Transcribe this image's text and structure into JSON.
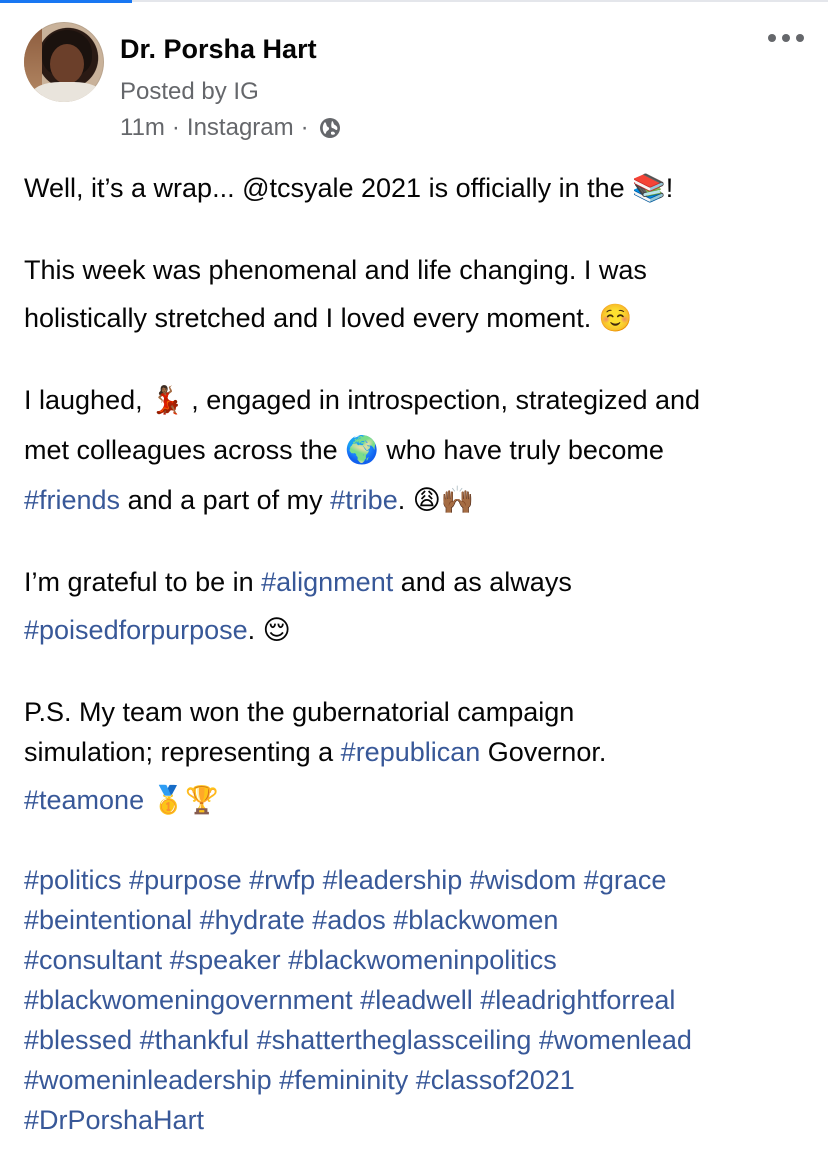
{
  "post": {
    "author": "Dr. Porsha Hart",
    "posted_by": "Posted by IG",
    "time": "11m",
    "source": "Instagram",
    "separator": "·",
    "icons": {
      "privacy": "globe-icon",
      "menu": "more-options-icon"
    }
  },
  "body": {
    "p1": {
      "l1": "Well, it’s  a wrap... @tcsyale 2021 is officially in the 📚!"
    },
    "p2": {
      "l1": "This week was phenomenal and life changing. I was",
      "l2": "holistically stretched  and I loved every moment. ☺️"
    },
    "p3": {
      "l1": "I laughed, 💃🏾 , engaged in introspection, strategized and",
      "l2": "met colleagues across the 🌍 who have truly become",
      "l3_tag1": "#friends",
      "l3_text1": " and a part of my ",
      "l3_tag2": "#tribe",
      "l3_text2": ".  😩🙌🏾"
    },
    "p4": {
      "l1_text1": "I’m grateful to be in ",
      "l1_tag1": "#alignment",
      "l1_text2": " and as always",
      "l2_tag1": "#poisedforpurpose",
      "l2_text1": ". 😌"
    },
    "p5": {
      "l1": "P.S. My team won the gubernatorial campaign",
      "l2_text1": "simulation; representing a ",
      "l2_tag1": "#republican",
      "l2_text2": " Governor.",
      "l3_tag1": "#teamone",
      "l3_text1": " 🥇🏆"
    },
    "hashtags": [
      "#politics #purpose #rwfp #leadership #wisdom #grace",
      "#beintentional #hydrate #ados #blackwomen",
      "#consultant #speaker #blackwomeninpolitics",
      "#blackwomeningovernment #leadwell #leadrightforreal",
      "#blessed #thankful #shattertheglassceiling #womenlead",
      "#womeninleadership #femininity #classof2021",
      "#DrPorshaHart"
    ]
  },
  "colors": {
    "link": "#385898",
    "secondary_text": "#65676b",
    "primary_text": "#050505"
  }
}
